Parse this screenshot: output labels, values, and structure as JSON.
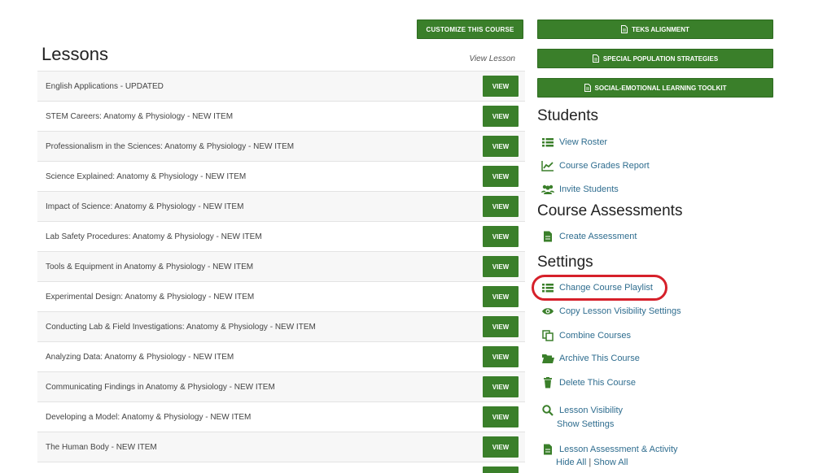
{
  "left": {
    "customize_label": "CUSTOMIZE THIS COURSE",
    "title": "Lessons",
    "view_lesson_label": "View Lesson",
    "view_label": "VIEW",
    "lessons": [
      "English Applications - UPDATED",
      "STEM Careers: Anatomy & Physiology - NEW ITEM",
      "Professionalism in the Sciences: Anatomy & Physiology - NEW ITEM",
      "Science Explained: Anatomy & Physiology - NEW ITEM",
      "Impact of Science: Anatomy & Physiology - NEW ITEM",
      "Lab Safety Procedures: Anatomy & Physiology - NEW ITEM",
      "Tools & Equipment in Anatomy & Physiology - NEW ITEM",
      "Experimental Design: Anatomy & Physiology - NEW ITEM",
      "Conducting Lab & Field Investigations: Anatomy & Physiology - NEW ITEM",
      "Analyzing Data: Anatomy & Physiology - NEW ITEM",
      "Communicating Findings in Anatomy & Physiology - NEW ITEM",
      "Developing a Model: Anatomy & Physiology - NEW ITEM",
      "The Human Body - NEW ITEM",
      ""
    ]
  },
  "right": {
    "teks_label": "TEKS ALIGNMENT",
    "special_label": "SPECIAL POPULATION STRATEGIES",
    "sel_label": "SOCIAL-EMOTIONAL LEARNING TOOLKIT",
    "students_title": "Students",
    "view_roster": "View Roster",
    "grades_report": "Course Grades Report",
    "invite_students": "Invite Students",
    "assessments_title": "Course Assessments",
    "create_assessment": "Create Assessment",
    "settings_title": "Settings",
    "change_playlist": "Change Course Playlist",
    "copy_visibility": "Copy Lesson Visibility Settings",
    "combine_courses": "Combine Courses",
    "archive_course": "Archive This Course",
    "delete_course": "Delete This Course",
    "lesson_visibility": "Lesson Visibility",
    "show_settings": "Show Settings",
    "lesson_assessment": "Lesson Assessment & Activity",
    "hide_all": "Hide All",
    "separator": "|",
    "show_all": "Show All"
  },
  "colors": {
    "brand_green": "#3a7f2a",
    "link_blue": "#2f6d8f",
    "highlight_red": "#d6202a"
  }
}
